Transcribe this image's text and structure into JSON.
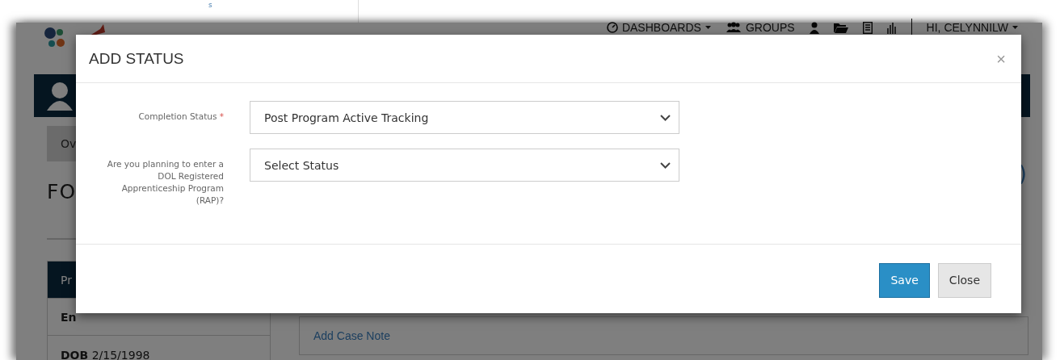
{
  "top_strip": {
    "mark": "s"
  },
  "backdrop": {
    "nav": [
      {
        "kind": "dashboards",
        "label": "DASHBOARDS"
      },
      {
        "kind": "groups",
        "label": "GROUPS"
      },
      {
        "kind": "person"
      },
      {
        "kind": "folder"
      },
      {
        "kind": "list"
      },
      {
        "kind": "chart"
      },
      {
        "kind": "user",
        "label": "HI, CELYNNILW"
      }
    ],
    "tab_fragment": "Ov",
    "heading_fragment": "FO",
    "side_fragment": ")",
    "rows": [
      {
        "kind": "header",
        "text": "Pr"
      },
      {
        "kind": "bold",
        "text": "En"
      },
      {
        "kind": "pair",
        "label": "DOB",
        "value": "2/15/1998"
      }
    ],
    "case_note_link": "Add Case Note"
  },
  "modal": {
    "title": "ADD STATUS",
    "close_symbol": "×",
    "fields": [
      {
        "label": "Completion Status",
        "required_mark": "*",
        "value": "Post Program Active Tracking"
      },
      {
        "label": "Are you planning to enter a DOL Registered Apprenticeship Program (RAP)?",
        "value": "Select Status"
      }
    ],
    "buttons": [
      {
        "kind": "primary",
        "label": "Save"
      },
      {
        "kind": "default",
        "label": "Close"
      }
    ]
  }
}
